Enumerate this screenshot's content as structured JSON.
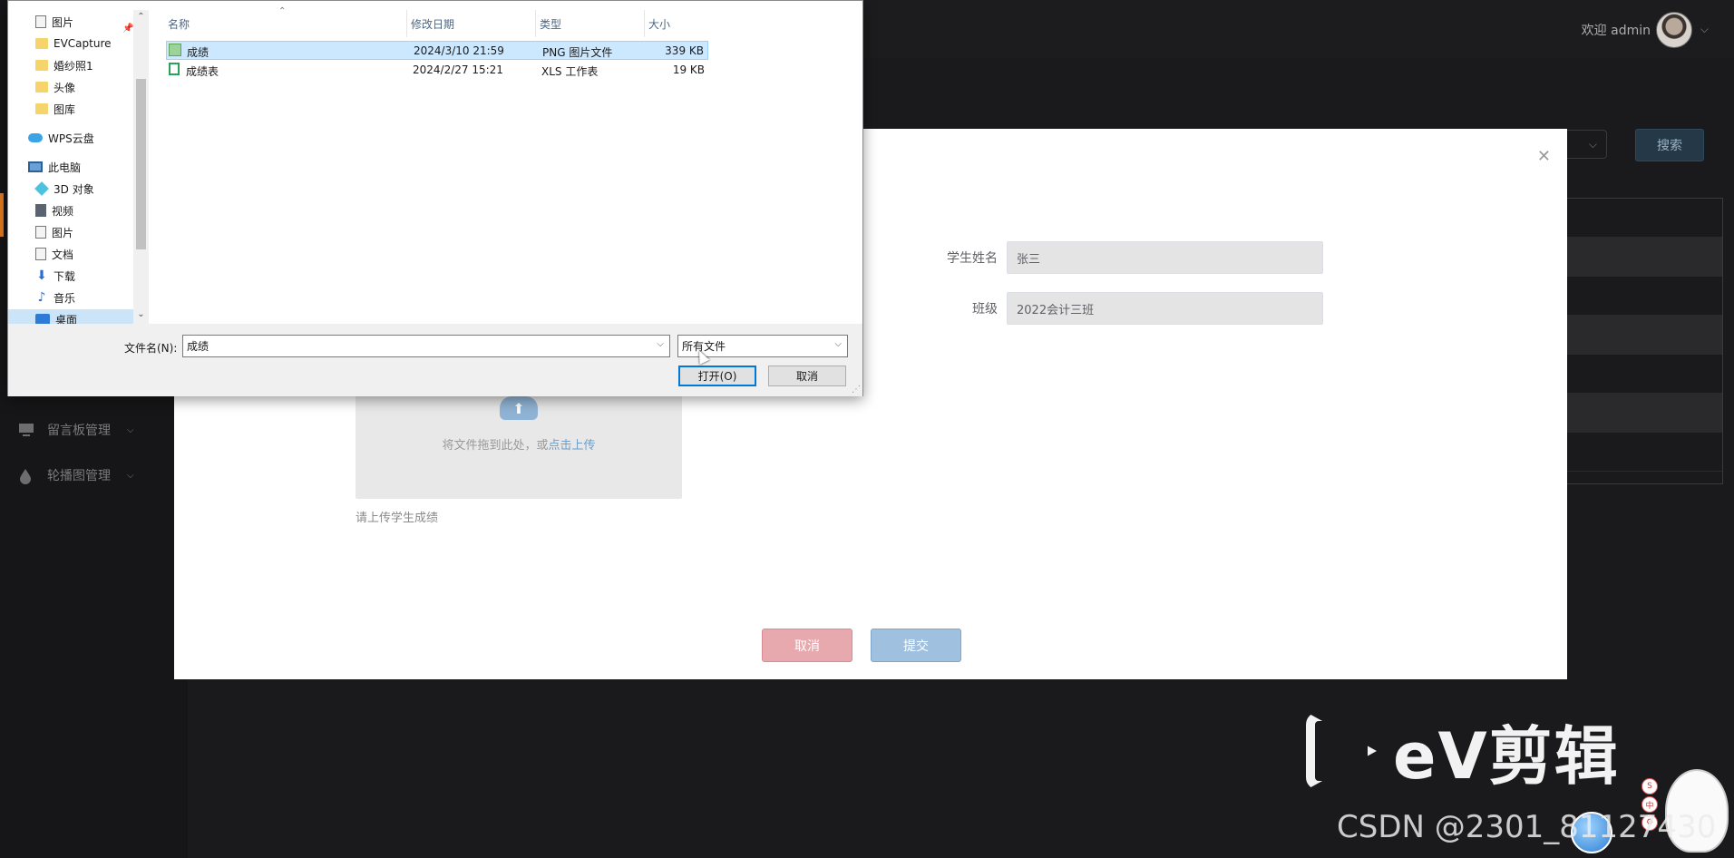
{
  "admin": {
    "welcome": "欢迎 admin",
    "search_button": "搜索",
    "sidebar": [
      {
        "label": "留言板管理",
        "icon": "monitor-icon"
      },
      {
        "label": "轮播图管理",
        "icon": "drop-icon"
      }
    ]
  },
  "modal": {
    "fields": [
      {
        "label": "学生姓名",
        "value": "张三"
      },
      {
        "label": "班级",
        "value": "2022会计三班"
      }
    ],
    "upload": {
      "text": "将文件拖到此处，或",
      "link": "点击上传",
      "tip": "请上传学生成绩"
    },
    "cancel_label": "取消",
    "submit_label": "提交"
  },
  "dialog": {
    "nav_items": [
      {
        "label": "图片",
        "icon": "picture-folder-icon"
      },
      {
        "label": "EVCapture",
        "icon": "folder-icon"
      },
      {
        "label": "婚纱照1",
        "icon": "folder-icon"
      },
      {
        "label": "头像",
        "icon": "folder-icon"
      },
      {
        "label": "图库",
        "icon": "folder-icon"
      },
      {
        "label": "WPS云盘",
        "icon": "cloud-icon"
      },
      {
        "label": "此电脑",
        "icon": "computer-icon"
      },
      {
        "label": "3D 对象",
        "icon": "cube-icon"
      },
      {
        "label": "视频",
        "icon": "video-icon"
      },
      {
        "label": "图片",
        "icon": "picture-icon"
      },
      {
        "label": "文档",
        "icon": "document-icon"
      },
      {
        "label": "下载",
        "icon": "download-icon"
      },
      {
        "label": "音乐",
        "icon": "music-icon"
      },
      {
        "label": "桌面",
        "icon": "desktop-icon"
      }
    ],
    "columns": [
      "名称",
      "修改日期",
      "类型",
      "大小"
    ],
    "files": [
      {
        "name": "成绩",
        "date": "2024/3/10 21:59",
        "type": "PNG 图片文件",
        "size": "339 KB",
        "icon": "image-file-icon",
        "selected": true
      },
      {
        "name": "成绩表",
        "date": "2024/2/27 15:21",
        "type": "XLS 工作表",
        "size": "19 KB",
        "icon": "xls-file-icon",
        "selected": false
      }
    ],
    "filename_label": "文件名(N):",
    "filename_value": "成绩",
    "filetype_value": "所有文件",
    "open_label": "打开(O)",
    "cancel_label": "取消"
  },
  "watermark": {
    "ev_text": "eV剪辑",
    "csdn": "CSDN @2301_81127430"
  },
  "colors": {
    "accent_orange": "#e07a1e",
    "dialog_selection": "#cce8ff",
    "cancel_btn": "#e8a9ae",
    "submit_btn": "#9fc0de"
  }
}
